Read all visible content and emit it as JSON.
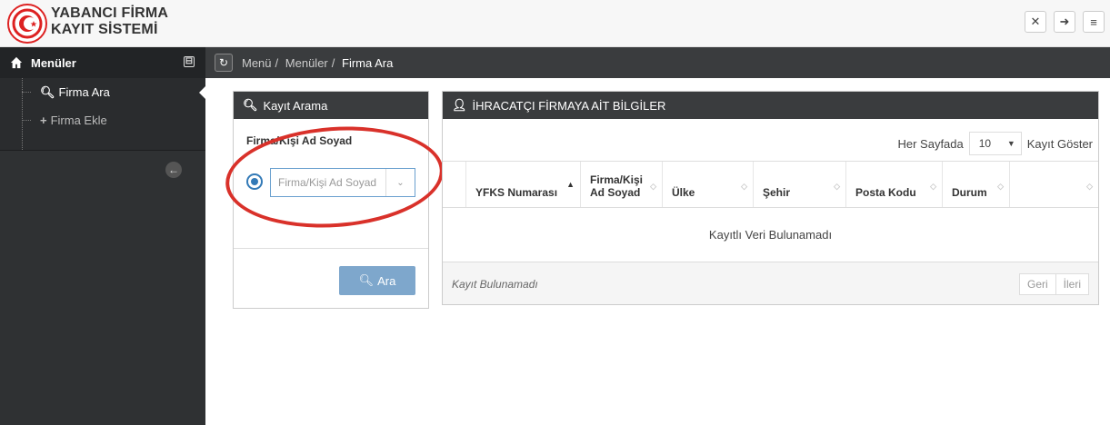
{
  "header": {
    "brand_line1": "YABANCI FİRMA",
    "brand_line2": "KAYIT SİSTEMİ",
    "icons": [
      "fullscreen-icon",
      "logout-icon",
      "hamburger-icon"
    ]
  },
  "sidebar": {
    "title": "Menüler",
    "collapse_symbol": "⊟",
    "items": [
      {
        "label": "Firma Ara",
        "icon": "search-icon",
        "active": true
      },
      {
        "label": "Firma Ekle",
        "icon": "plus-icon",
        "active": false
      }
    ]
  },
  "breadcrumb": {
    "items": [
      "Menü",
      "Menüler",
      "Firma Ara"
    ]
  },
  "search_panel": {
    "title": "Kayıt Arama",
    "field_label": "Firma/Kişi Ad Soyad",
    "select_placeholder": "Firma/Kişi Ad Soyad",
    "search_button": "Ara"
  },
  "results_panel": {
    "title": "İHRACATÇI FİRMAYA AİT BİLGİLER",
    "per_page_prefix": "Her Sayfada",
    "per_page_value": "10",
    "per_page_suffix": "Kayıt Göster",
    "columns": [
      "YFKS Numarası",
      "Firma/Kişi Ad Soyad",
      "Ülke",
      "Şehir",
      "Posta Kodu",
      "Durum",
      ""
    ],
    "empty_message": "Kayıtlı Veri Bulunamadı",
    "footer_text": "Kayıt Bulunamadı",
    "pager": {
      "prev": "Geri",
      "next": "İleri"
    }
  },
  "colors": {
    "annotation_circle": "#d9312a",
    "primary_button": "#7ea7cc",
    "sidebar_bg": "#2f3133",
    "panel_header_bg": "#3a3c3e"
  }
}
